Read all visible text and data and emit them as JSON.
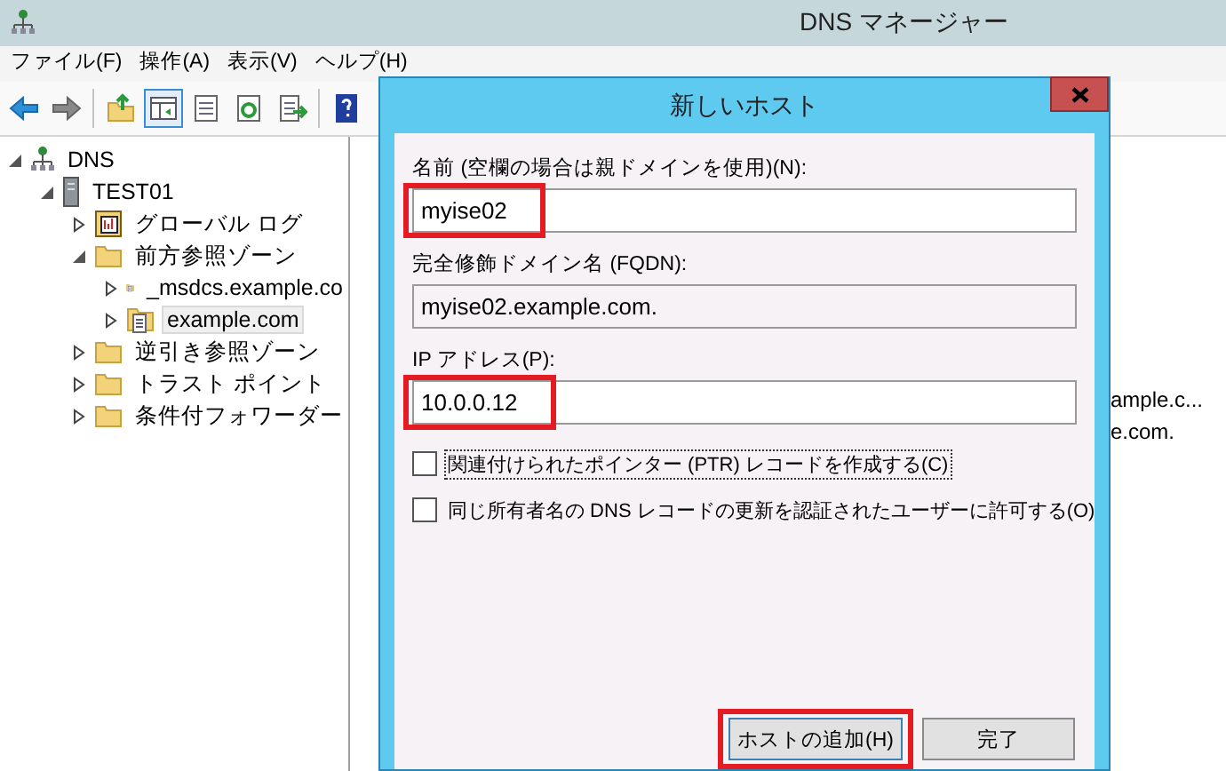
{
  "window": {
    "title": "DNS マネージャー"
  },
  "menu": [
    "ファイル(F)",
    "操作(A)",
    "表示(V)",
    "ヘルプ(H)"
  ],
  "toolbar": [
    {
      "kind": "back",
      "pressed": false
    },
    {
      "kind": "forward",
      "pressed": false
    },
    {
      "kind": "separator"
    },
    {
      "kind": "up",
      "pressed": false
    },
    {
      "kind": "pane",
      "pressed": true
    },
    {
      "kind": "list",
      "pressed": false
    },
    {
      "kind": "refresh",
      "pressed": false
    },
    {
      "kind": "export",
      "pressed": false
    },
    {
      "kind": "separator"
    },
    {
      "kind": "help",
      "pressed": false
    }
  ],
  "tree": [
    {
      "label": "DNS",
      "kind": "dns",
      "expanded": true,
      "selected": false,
      "children": [
        {
          "label": "TEST01",
          "kind": "server",
          "expanded": true,
          "selected": false,
          "children": [
            {
              "label": "グローバル ログ",
              "kind": "log",
              "expanded": false,
              "selected": false
            },
            {
              "label": "前方参照ゾーン",
              "kind": "folder",
              "expanded": true,
              "selected": false,
              "children": [
                {
                  "label": "_msdcs.example.co",
                  "kind": "zone",
                  "expanded": false,
                  "selected": false
                },
                {
                  "label": "example.com",
                  "kind": "zone",
                  "expanded": false,
                  "selected": true
                }
              ]
            },
            {
              "label": "逆引き参照ゾーン",
              "kind": "folder",
              "expanded": false,
              "selected": false
            },
            {
              "label": "トラスト ポイント",
              "kind": "folder",
              "expanded": false,
              "selected": false
            },
            {
              "label": "条件付フォワーダー",
              "kind": "folder",
              "expanded": false,
              "selected": false
            }
          ]
        }
      ]
    }
  ],
  "list": {
    "rows": [
      "ample.c...",
      "e.com."
    ]
  },
  "dialog": {
    "title": "新しいホスト",
    "fields": [
      {
        "kind": "input",
        "label": "名前 (空欄の場合は親ドメインを使用)(N):",
        "value": "myise02",
        "highlighted": true
      },
      {
        "kind": "readonly",
        "label": "完全修飾ドメイン名 (FQDN):",
        "value": "myise02.example.com.",
        "highlighted": false
      },
      {
        "kind": "input",
        "label": "IP アドレス(P):",
        "value": "10.0.0.12",
        "highlighted": true
      }
    ],
    "checkboxes": [
      {
        "label": "関連付けられたポインター (PTR) レコードを作成する(C)",
        "checked": false,
        "focused": true
      },
      {
        "label": "同じ所有者名の DNS レコードの更新を認証されたユーザーに許可する(O)",
        "checked": false,
        "focused": false
      }
    ],
    "buttons": [
      {
        "label": "ホストの追加(H)",
        "default": true,
        "highlighted": true
      },
      {
        "label": "完了",
        "default": false,
        "highlighted": false
      }
    ]
  }
}
